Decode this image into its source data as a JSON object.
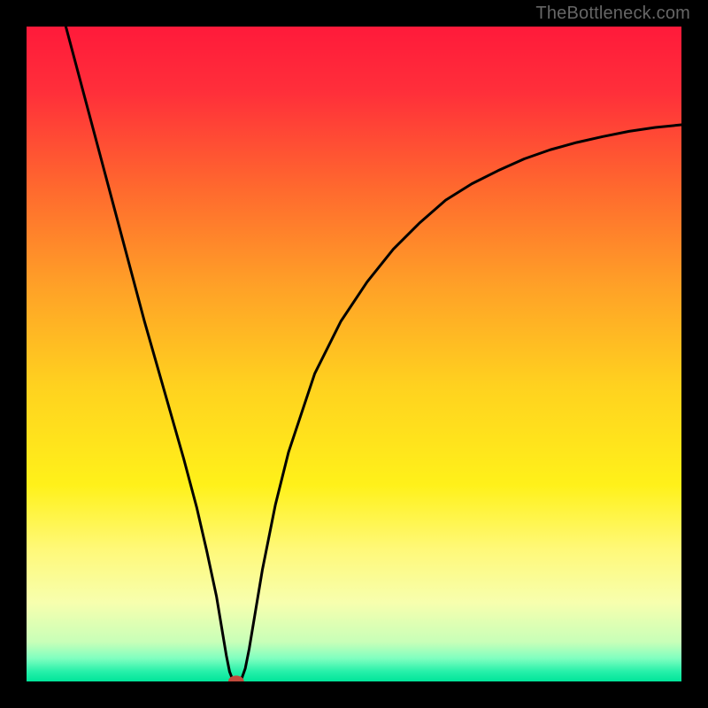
{
  "watermark": "TheBottleneck.com",
  "chart_data": {
    "type": "line",
    "title": "",
    "xlabel": "",
    "ylabel": "",
    "xlim": [
      0,
      100
    ],
    "ylim": [
      0,
      100
    ],
    "background": {
      "type": "vertical-gradient",
      "stops": [
        {
          "offset": 0.0,
          "color": "#ff1a3a"
        },
        {
          "offset": 0.1,
          "color": "#ff2f3a"
        },
        {
          "offset": 0.25,
          "color": "#ff6a2e"
        },
        {
          "offset": 0.4,
          "color": "#ffa227"
        },
        {
          "offset": 0.55,
          "color": "#ffd21f"
        },
        {
          "offset": 0.7,
          "color": "#fff11a"
        },
        {
          "offset": 0.8,
          "color": "#fff97a"
        },
        {
          "offset": 0.88,
          "color": "#f7ffae"
        },
        {
          "offset": 0.94,
          "color": "#c8ffb8"
        },
        {
          "offset": 0.965,
          "color": "#7fffc0"
        },
        {
          "offset": 0.985,
          "color": "#26f0a9"
        },
        {
          "offset": 1.0,
          "color": "#00e59a"
        }
      ]
    },
    "series": [
      {
        "name": "bottleneck-curve",
        "color": "#000000",
        "x": [
          6,
          8,
          10,
          12,
          14,
          16,
          18,
          20,
          22,
          24,
          26,
          27.5,
          29,
          30,
          30.5,
          31,
          31.5,
          31.8,
          32.2,
          32.8,
          33.4,
          34,
          35,
          36,
          38,
          40,
          44,
          48,
          52,
          56,
          60,
          64,
          68,
          72,
          76,
          80,
          84,
          88,
          92,
          96,
          100
        ],
        "y": [
          100,
          92.5,
          85,
          77.5,
          70,
          62.5,
          55,
          48,
          41,
          34,
          26.5,
          20,
          13,
          7,
          4,
          1.5,
          0.2,
          0,
          0,
          0.3,
          2,
          5,
          11,
          17,
          27,
          35,
          47,
          55,
          61,
          66,
          70,
          73.5,
          76,
          78,
          79.8,
          81.2,
          82.3,
          83.2,
          84,
          84.6,
          85
        ]
      }
    ],
    "marker": {
      "name": "optimal-point",
      "x": 32,
      "y": 0,
      "color": "#c24a3c",
      "rx": 1.2,
      "ry": 0.9
    }
  }
}
